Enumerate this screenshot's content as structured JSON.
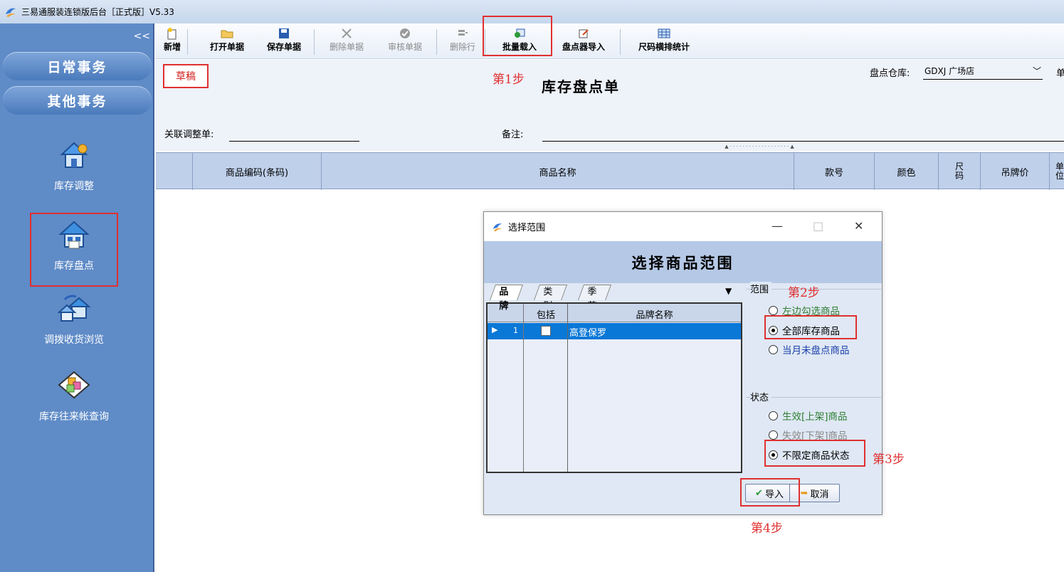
{
  "window": {
    "title": "三易通服装连锁版后台［正式版］V5.33"
  },
  "sidebar": {
    "collapse_glyph": "<<",
    "sections": [
      "日常事务",
      "其他事务"
    ],
    "items": [
      {
        "label": "库存调整"
      },
      {
        "label": "库存盘点"
      },
      {
        "label": "调拨收货浏览"
      },
      {
        "label": "库存往来帐查询"
      }
    ]
  },
  "toolbar": {
    "buttons": [
      {
        "label": "新增",
        "enabled": true
      },
      {
        "label": "打开单据",
        "enabled": true
      },
      {
        "label": "保存单据",
        "enabled": true
      },
      {
        "label": "删除单据",
        "enabled": false
      },
      {
        "label": "审核单据",
        "enabled": false
      },
      {
        "label": "删除行",
        "enabled": false
      },
      {
        "label": "批量载入",
        "enabled": true
      },
      {
        "label": "盘点器导入",
        "enabled": true
      },
      {
        "label": "尺码横排统计",
        "enabled": true
      }
    ]
  },
  "form": {
    "status": "草稿",
    "title": "库存盘点单",
    "warehouse_label": "盘点仓库:",
    "warehouse_value": "GDXJ 广场店",
    "cut_label": "单",
    "related_label": "关联调整单:",
    "related_value": "",
    "remark_label": "备注:",
    "remark_value": ""
  },
  "grid": {
    "columns": [
      "商品编码(条码)",
      "商品名称",
      "款号",
      "颜色",
      "尺码",
      "吊牌价",
      "单位"
    ]
  },
  "annotations": {
    "step1": "第1步",
    "step2": "第2步",
    "step3": "第3步",
    "step4": "第4步"
  },
  "dialog": {
    "title": "选择范围",
    "banner": "选择商品范围",
    "tabs": [
      "品牌",
      "类别",
      "季节"
    ],
    "brand_grid": {
      "headers": [
        "包括",
        "品牌名称"
      ],
      "rows": [
        {
          "index": "1",
          "included": false,
          "name": "高登保罗"
        }
      ]
    },
    "range": {
      "label": "范围",
      "options": [
        {
          "label": "左边勾选商品",
          "selected": false,
          "color": "#2e7d32"
        },
        {
          "label": "全部库存商品",
          "selected": true,
          "color": "#000000"
        },
        {
          "label": "当月未盘点商品",
          "selected": false,
          "color": "#1a3fa8"
        }
      ]
    },
    "status": {
      "label": "状态",
      "options": [
        {
          "label": "生效[上架]商品",
          "selected": false,
          "color": "#2e7d32"
        },
        {
          "label": "失效[下架]商品",
          "selected": false,
          "color": "#888888"
        },
        {
          "label": "不限定商品状态",
          "selected": true,
          "color": "#000000"
        }
      ]
    },
    "import_label": "导入",
    "cancel_label": "取消"
  },
  "colors": {
    "accent_red": "#e03030",
    "sidebar": "#5f8bc7",
    "selection": "#0a78d7"
  }
}
